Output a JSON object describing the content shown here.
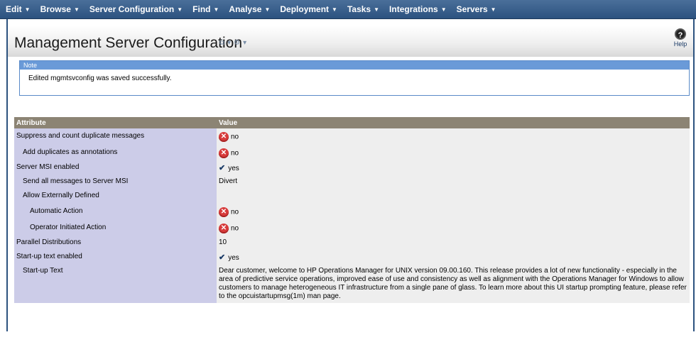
{
  "menu": {
    "items": [
      {
        "label": "Edit"
      },
      {
        "label": "Browse"
      },
      {
        "label": "Server Configuration"
      },
      {
        "label": "Find"
      },
      {
        "label": "Analyse"
      },
      {
        "label": "Deployment"
      },
      {
        "label": "Tasks"
      },
      {
        "label": "Integrations"
      },
      {
        "label": "Servers"
      }
    ]
  },
  "page": {
    "title": "Management Server Configuration",
    "help_label": "Help",
    "help_symbol": "?"
  },
  "note": {
    "header": "Note",
    "text": "Edited mgmtsvconfig was saved successfully."
  },
  "table": {
    "col_attribute": "Attribute",
    "col_value": "Value",
    "rows": [
      {
        "attribute": "Suppress and count duplicate messages",
        "value": "no",
        "icon": "error-x-icon"
      },
      {
        "attribute": "Add duplicates as annotations",
        "value": "no",
        "icon": "error-x-icon"
      },
      {
        "attribute": "Server MSI enabled",
        "value": "yes",
        "icon": "checkmark-icon"
      },
      {
        "attribute": "Send all messages to Server MSI",
        "value": "Divert"
      },
      {
        "attribute": "Allow Externally Defined",
        "value": ""
      },
      {
        "attribute": "Automatic Action",
        "value": "no",
        "icon": "error-x-icon"
      },
      {
        "attribute": "Operator Initiated Action",
        "value": "no",
        "icon": "error-x-icon"
      },
      {
        "attribute": "Parallel Distributions",
        "value": "10"
      },
      {
        "attribute": "Start-up text enabled",
        "value": "yes",
        "icon": "checkmark-icon"
      },
      {
        "attribute": "Start-up Text",
        "value": "Dear customer, welcome to HP Operations Manager for UNIX version 09.00.160. This release provides a lot of new functionality - especially in the area of predictive service operations, improved ease of use and consistency as well as alignment with the Operations Manager for Windows to allow customers to manage heterogeneous IT infrastructure from a single pane of glass. To learn more about this UI startup prompting feature, please refer to the opcuistartupmsg(1m) man page."
      }
    ]
  },
  "colors": {
    "menubar": "#2c527f",
    "attr_bg": "#cccce8",
    "value_bg": "#eeeeee",
    "header_bg": "#8c8474",
    "note_header": "#6a9ad8",
    "error_icon": "#d73b3b"
  }
}
